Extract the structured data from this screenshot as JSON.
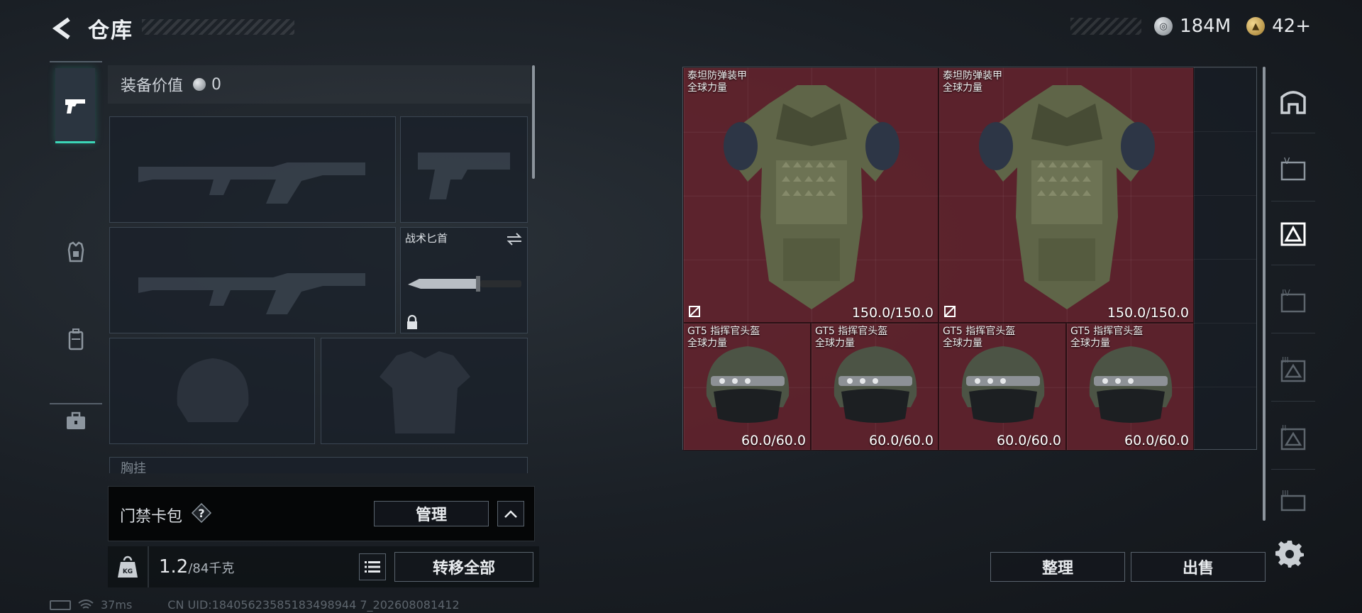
{
  "header": {
    "title": "仓库",
    "currencies": [
      {
        "icon": "silver-coin-icon",
        "value": "184M"
      },
      {
        "icon": "gold-coin-icon",
        "value": "42+"
      }
    ]
  },
  "loadout": {
    "value_label": "装备价值",
    "value": "0",
    "knife_slot_label": "战术匕首",
    "chest_rig_label": "胸挂",
    "card_pack_label": "门禁卡包",
    "help_glyph": "?",
    "manage_label": "管理",
    "weight_current": "1.2",
    "weight_max": "/84千克",
    "weight_icon_text": "KG",
    "transfer_all_label": "转移全部"
  },
  "storage": {
    "items": [
      {
        "name_line1": "泰坦防弹装甲",
        "name_line2": "全球力量",
        "durability": "150.0/150.0"
      },
      {
        "name_line1": "泰坦防弹装甲",
        "name_line2": "全球力量",
        "durability": "150.0/150.0"
      },
      {
        "name_line1": "GT5 指挥官头盔",
        "name_line2": "全球力量",
        "durability": "60.0/60.0"
      },
      {
        "name_line1": "GT5 指挥官头盔",
        "name_line2": "全球力量",
        "durability": "60.0/60.0"
      },
      {
        "name_line1": "GT5 指挥官头盔",
        "name_line2": "全球力量",
        "durability": "60.0/60.0"
      },
      {
        "name_line1": "GT5 指挥官头盔",
        "name_line2": "全球力量",
        "durability": "60.0/60.0"
      }
    ],
    "sort_label": "整理",
    "sell_label": "出售"
  },
  "tiers": [
    "V",
    "IV",
    "III",
    "II",
    "III"
  ],
  "status": {
    "ping": "37ms",
    "uid": "CN UID:18405623585183498944 7_202608081412"
  },
  "colors": {
    "accent": "#3bd6b7",
    "item_bg": "#6e242e"
  }
}
